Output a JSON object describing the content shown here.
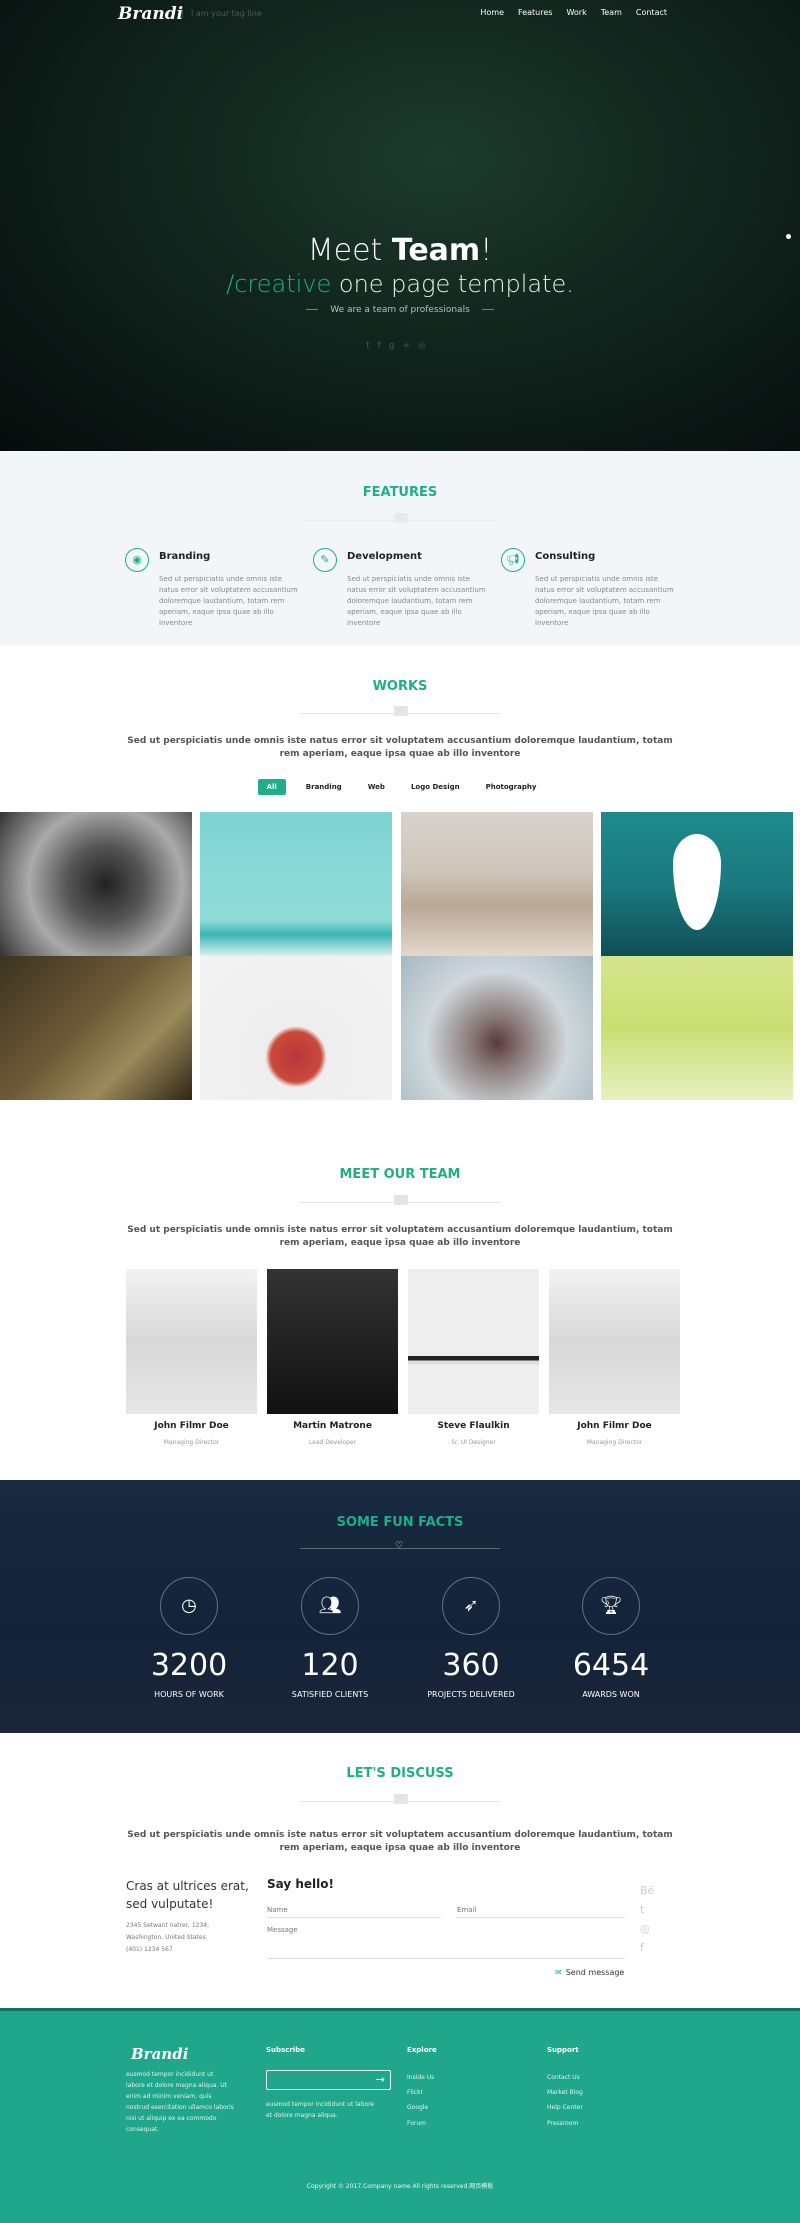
{
  "nav": {
    "logo": "Brandi",
    "tagline": "I am your tag line",
    "items": [
      "Home",
      "Features",
      "Work",
      "Team",
      "Contact"
    ]
  },
  "hero": {
    "title_a": "Meet ",
    "title_b": "Team",
    "title_c": "!",
    "sub_accent": "/creative",
    "sub_rest": " one page template.",
    "line": "We are a team of professionals",
    "social": [
      "twitter-icon",
      "facebook-icon",
      "google-plus-icon",
      "dribbble-icon"
    ]
  },
  "features": {
    "title": "FEATURES",
    "items": [
      {
        "icon": "github-icon",
        "title": "Branding",
        "text": "Sed ut perspiciatis unde omnis iste natus error sit voluptatem accusantium doloremque laudantium, totam rem aperiam, eaque ipsa quae ab illo inventore"
      },
      {
        "icon": "pencil-icon",
        "title": "Development",
        "text": "Sed ut perspiciatis unde omnis iste natus error sit voluptatem accusantium doloremque laudantium, totam rem aperiam, eaque ipsa quae ab illo inventore"
      },
      {
        "icon": "bullhorn-icon",
        "title": "Consulting",
        "text": "Sed ut perspiciatis unde omnis iste natus error sit voluptatem accusantium doloremque laudantium, totam rem aperiam, eaque ipsa quae ab illo inventore"
      }
    ]
  },
  "works": {
    "title": "WORKS",
    "text": "Sed ut perspiciatis unde omnis iste natus error sit voluptatem accusantium doloremque laudantium, totam rem aperiam, eaque ipsa quae ab illo inventore",
    "filters": [
      "All",
      "Branding",
      "Web",
      "Logo Design",
      "Photography"
    ],
    "active_filter": "All"
  },
  "team": {
    "title": "MEET OUR TEAM",
    "text": "Sed ut perspiciatis unde omnis iste natus error sit voluptatem accusantium doloremque laudantium, totam rem aperiam, eaque ipsa quae ab illo inventore",
    "members": [
      {
        "name": "John Filmr Doe",
        "role": "Managing Director"
      },
      {
        "name": "Martin Matrone",
        "role": "Lead Developer"
      },
      {
        "name": "Steve Flaulkin",
        "role": "Sr. UI Designer"
      },
      {
        "name": "John Filmr Doe",
        "role": "Managing Director"
      }
    ]
  },
  "facts": {
    "title": "SOME FUN FACTS",
    "items": [
      {
        "icon": "clock-icon",
        "value": "3200",
        "label": "HOURS OF WORK"
      },
      {
        "icon": "users-icon",
        "value": "120",
        "label": "SATISFIED CLIENTS"
      },
      {
        "icon": "rocket-icon",
        "value": "360",
        "label": "PROJECTS DELIVERED"
      },
      {
        "icon": "trophy-icon",
        "value": "6454",
        "label": "AWARDS WON"
      }
    ]
  },
  "discuss": {
    "title": "LET'S DISCUSS",
    "text": "Sed ut perspiciatis unde omnis iste natus error sit voluptatem accusantium doloremque laudantium, totam rem aperiam, eaque ipsa quae ab illo inventore",
    "heading": "Cras at ultrices erat, sed vulputate!",
    "address": [
      "2345 Setwant natrer, 1234,",
      "Washington. United States.",
      "(401) 1234 567"
    ],
    "form_title": "Say hello!",
    "name_placeholder": "Name",
    "email_placeholder": "Email",
    "message_placeholder": "Message",
    "send": "Send message",
    "social": [
      "behance-icon",
      "twitter-icon",
      "dribbble-icon",
      "facebook-icon"
    ]
  },
  "footer": {
    "logo": "Brandi",
    "about": "eusmod tempor incididunt ut labore et dolore magna aliqua. Ut enim ad minim veniam, quis nostrud exercitation ullamco laboris nisi ut aliquip ex ea commodo consequat.",
    "subscribe_title": "Subscribe",
    "subscribe_text": "eusmod tempor incididunt ut labore et dolore magna aliqua.",
    "explore_title": "Explore",
    "explore": [
      "Inside Us",
      "Flickr",
      "Google",
      "Forum"
    ],
    "support_title": "Support",
    "support": [
      "Contact Us",
      "Market Blog",
      "Help Center",
      "Pressroom"
    ],
    "copyright": "Copyright © 2017.Company name All rights reserved.网页模板"
  },
  "colors": {
    "accent": "#1fae87",
    "footer": "#20a68a",
    "facts_bg": "#182a40"
  }
}
